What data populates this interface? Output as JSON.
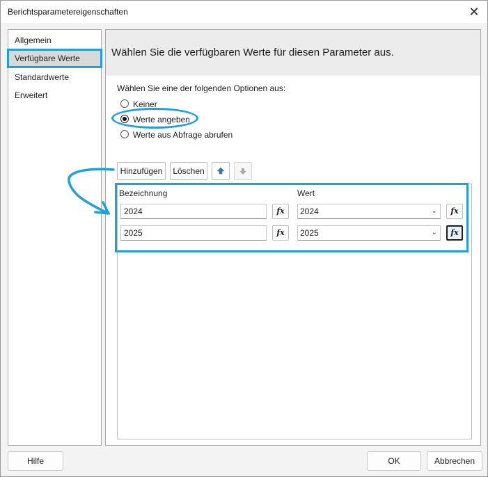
{
  "window": {
    "title": "Berichtsparametereigenschaften",
    "close_glyph": "✕"
  },
  "sidebar": {
    "items": [
      {
        "label": "Allgemein",
        "active": false
      },
      {
        "label": "Verfügbare Werte",
        "active": true
      },
      {
        "label": "Standardwerte",
        "active": false
      },
      {
        "label": "Erweitert",
        "active": false
      }
    ]
  },
  "main": {
    "heading": "Wählen Sie die verfügbaren Werte für diesen Parameter aus.",
    "options_prompt": "Wählen Sie eine der folgenden Optionen aus:",
    "radios": [
      {
        "label": "Keiner",
        "checked": false
      },
      {
        "label": "Werte angeben",
        "checked": true
      },
      {
        "label": "Werte aus Abfrage abrufen",
        "checked": false
      }
    ],
    "toolbar": {
      "add_label": "Hinzufügen",
      "delete_label": "Löschen",
      "move_up_icon": "arrow-up-icon",
      "move_down_icon": "arrow-down-icon"
    },
    "grid": {
      "col_label": "Bezeichnung",
      "col_value": "Wert",
      "rows": [
        {
          "label": "2024",
          "value": "2024"
        },
        {
          "label": "2025",
          "value": "2025"
        }
      ],
      "fx_glyph": "fx"
    }
  },
  "buttons": {
    "help": "Hilfe",
    "ok": "OK",
    "cancel": "Abbrechen"
  },
  "colors": {
    "highlight": "#1fa0db",
    "selected_bg": "#d9d9d9"
  }
}
